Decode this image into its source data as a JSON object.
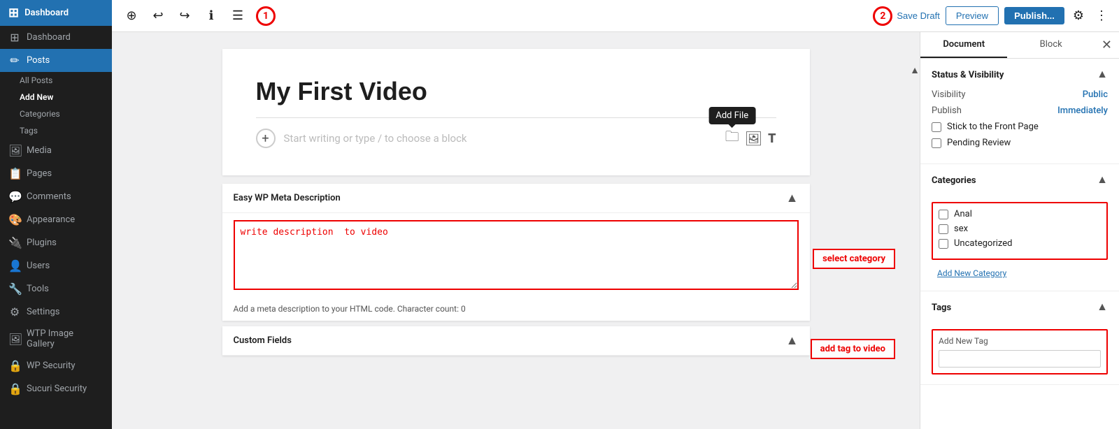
{
  "sidebar": {
    "logo": "Dashboard",
    "items": [
      {
        "id": "dashboard",
        "label": "Dashboard",
        "icon": "⊞"
      },
      {
        "id": "posts",
        "label": "Posts",
        "icon": "📄",
        "active": true
      },
      {
        "id": "all-posts",
        "label": "All Posts",
        "sub": true
      },
      {
        "id": "add-new",
        "label": "Add New",
        "sub": true,
        "active": true
      },
      {
        "id": "categories",
        "label": "Categories",
        "sub": true
      },
      {
        "id": "tags",
        "label": "Tags",
        "sub": true
      },
      {
        "id": "media",
        "label": "Media",
        "icon": "🖼"
      },
      {
        "id": "pages",
        "label": "Pages",
        "icon": "📋"
      },
      {
        "id": "comments",
        "label": "Comments",
        "icon": "💬"
      },
      {
        "id": "appearance",
        "label": "Appearance",
        "icon": "🎨"
      },
      {
        "id": "plugins",
        "label": "Plugins",
        "icon": "🔌"
      },
      {
        "id": "users",
        "label": "Users",
        "icon": "👤"
      },
      {
        "id": "tools",
        "label": "Tools",
        "icon": "🔧"
      },
      {
        "id": "settings",
        "label": "Settings",
        "icon": "⚙"
      },
      {
        "id": "wtp-image",
        "label": "WTP Image Gallery",
        "icon": "🖼"
      },
      {
        "id": "wp-security",
        "label": "WP Security",
        "icon": "🔒"
      },
      {
        "id": "sucuri",
        "label": "Sucuri Security",
        "icon": "🔒"
      }
    ]
  },
  "toolbar": {
    "add_block_label": "+",
    "undo_label": "↩",
    "redo_label": "↪",
    "info_label": "ℹ",
    "list_view_label": "☰",
    "save_draft_label": "Save Draft",
    "preview_label": "Preview",
    "publish_label": "Publish...",
    "settings_icon": "⚙",
    "more_icon": "⋮",
    "circle_1": "1",
    "circle_2": "2"
  },
  "editor": {
    "post_title": "My First Video",
    "block_placeholder": "Start writing or type / to choose a block",
    "add_file_tooltip": "Add File"
  },
  "meta_description": {
    "section_title": "Easy WP Meta Description",
    "textarea_placeholder": "write description  to video",
    "char_count_label": "Add a meta description to your HTML code. Character count: 0"
  },
  "right_panel": {
    "tab_document": "Document",
    "tab_block": "Block",
    "status_visibility_title": "Status & Visibility",
    "visibility_label": "Visibility",
    "visibility_value": "Public",
    "publish_label": "Publish",
    "publish_value": "Immediately",
    "stick_front_page": "Stick to the Front Page",
    "pending_review": "Pending Review",
    "categories_title": "Categories",
    "category_items": [
      "Anal",
      "sex",
      "Uncategorized"
    ],
    "add_new_category": "Add New Category",
    "tags_title": "Tags",
    "add_new_tag_label": "Add New Tag",
    "tags_input_placeholder": ""
  },
  "annotations": {
    "select_category": "select category",
    "add_tag_to_video": "add tag to video",
    "write_description": "write description  to video"
  },
  "colors": {
    "red": "#e00",
    "blue": "#2271b1",
    "dark": "#1e1e1e"
  }
}
